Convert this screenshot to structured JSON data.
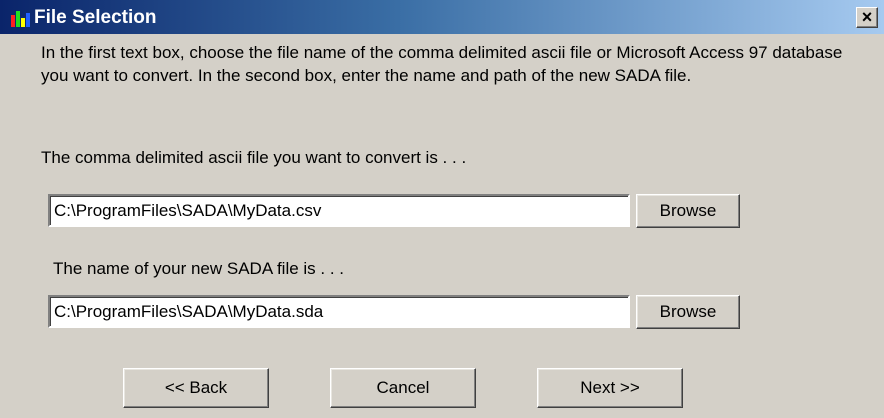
{
  "window": {
    "title": "File Selection",
    "close_glyph": "×",
    "app_icon": "bar-chart-icon",
    "colors": {
      "titlebar_start": "#0a246a",
      "titlebar_end": "#a6caf0",
      "face": "#d4d0c8"
    }
  },
  "instructions": "In the first text box, choose the file name of the comma delimited ascii file or Microsoft Access 97 database you want to convert. In the second box, enter the name and path of the new SADA file.",
  "source": {
    "label": "The comma delimited ascii file you want to convert is . . .",
    "value": "C:\\ProgramFiles\\SADA\\MyData.csv",
    "browse_label": "Browse"
  },
  "target": {
    "label": "The name of your new SADA file is . . .",
    "value": "C:\\ProgramFiles\\SADA\\MyData.sda",
    "browse_label": "Browse"
  },
  "nav": {
    "back_label": "<< Back",
    "cancel_label": "Cancel",
    "next_label": "Next >>"
  }
}
